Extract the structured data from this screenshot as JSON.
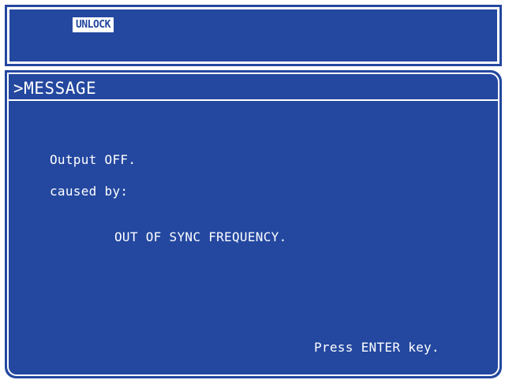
{
  "status": {
    "lock_label": "UNLOCK"
  },
  "message": {
    "title": ">MESSAGE",
    "line1": "Output OFF.",
    "line2": "caused by:",
    "cause": "OUT OF SYNC FREQUENCY.",
    "prompt": "Press ENTER key."
  },
  "colors": {
    "panel_bg": "#2448a0",
    "text": "#ffffff"
  }
}
